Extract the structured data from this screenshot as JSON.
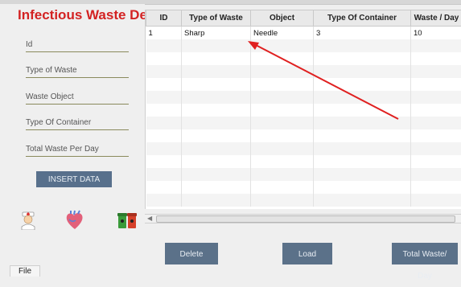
{
  "form": {
    "title": "Infectious Waste Details",
    "fields": [
      {
        "label": "Id"
      },
      {
        "label": "Type of Waste"
      },
      {
        "label": "Waste Object"
      },
      {
        "label": "Type Of Container"
      },
      {
        "label": "Total Waste Per Day"
      }
    ],
    "insert_label": "INSERT DATA",
    "icons": [
      "nurse-icon",
      "heart-organ-icon",
      "waste-bins-icon"
    ]
  },
  "table": {
    "columns": [
      "ID",
      "Type of Waste",
      "Object",
      "Type Of Container",
      "Waste / Day"
    ],
    "rows": [
      [
        "1",
        "Sharp",
        "Needle",
        "3",
        "10"
      ]
    ]
  },
  "actions": {
    "delete_label": "Delete",
    "load_label": "Load",
    "total_label": "Total Waste/ Day"
  },
  "menu": {
    "file_label": "File"
  },
  "colors": {
    "title": "#d32222",
    "button": "#5b7189",
    "annotation_arrow": "#e02020"
  }
}
